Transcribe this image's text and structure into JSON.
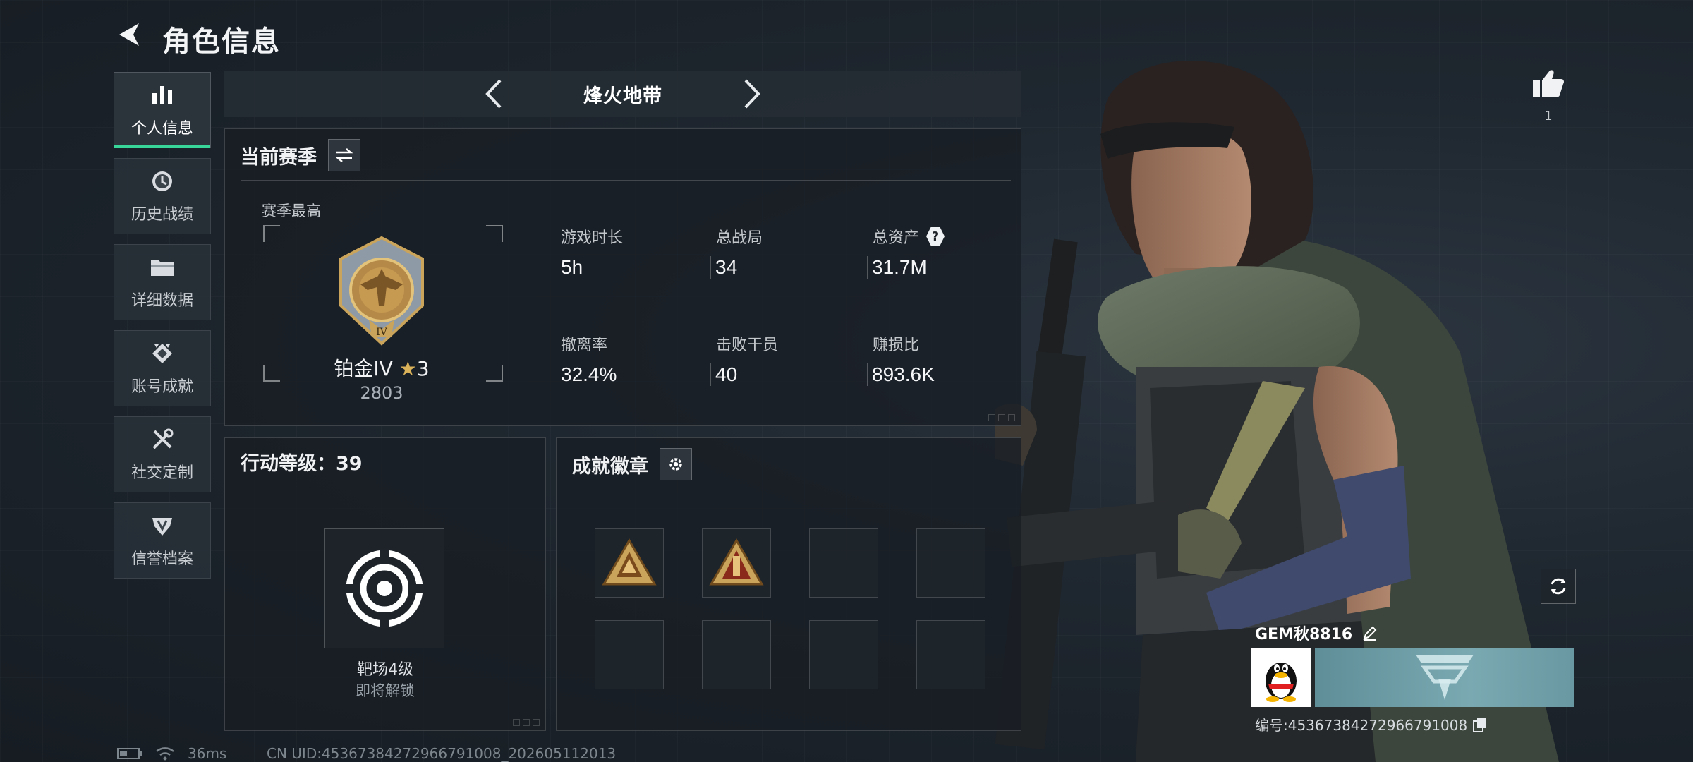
{
  "header": {
    "title": "角色信息"
  },
  "nav": {
    "items": [
      {
        "label": "个人信息",
        "icon": "bar-chart-icon",
        "active": true
      },
      {
        "label": "历史战绩",
        "icon": "clock-icon",
        "active": false
      },
      {
        "label": "详细数据",
        "icon": "folder-icon",
        "active": false
      },
      {
        "label": "账号成就",
        "icon": "achievement-icon",
        "active": false
      },
      {
        "label": "社交定制",
        "icon": "tools-icon",
        "active": false
      },
      {
        "label": "信誉档案",
        "icon": "credit-shield-icon",
        "active": false
      }
    ]
  },
  "mode": {
    "title": "烽火地带"
  },
  "season": {
    "heading": "当前赛季",
    "best_label": "赛季最高",
    "rank_name": "铂金IV",
    "rank_stars": "3",
    "rank_score": "2803",
    "stats": [
      {
        "label": "游戏时长",
        "value": "5h"
      },
      {
        "label": "总战局",
        "value": "34"
      },
      {
        "label": "总资产",
        "value": "31.7M"
      },
      {
        "label": "撤离率",
        "value": "32.4%"
      },
      {
        "label": "击败干员",
        "value": "40"
      },
      {
        "label": "赚损比",
        "value": "893.6K"
      }
    ],
    "help_mark": "?"
  },
  "action": {
    "heading": "行动等级：39",
    "target_name": "靶场4级",
    "target_sub": "即将解锁"
  },
  "badges": {
    "heading": "成就徽章"
  },
  "profile": {
    "likes": "1",
    "player_name": "GEM秋8816",
    "player_id": "编号:4536738427296679100​8"
  },
  "status": {
    "ping": "36ms",
    "uid": "CN UID:4536738427296679100​8_202605112013"
  },
  "colors": {
    "accent": "#39d69a",
    "gold": "#c9a45a",
    "card": "#7aa9b2"
  }
}
